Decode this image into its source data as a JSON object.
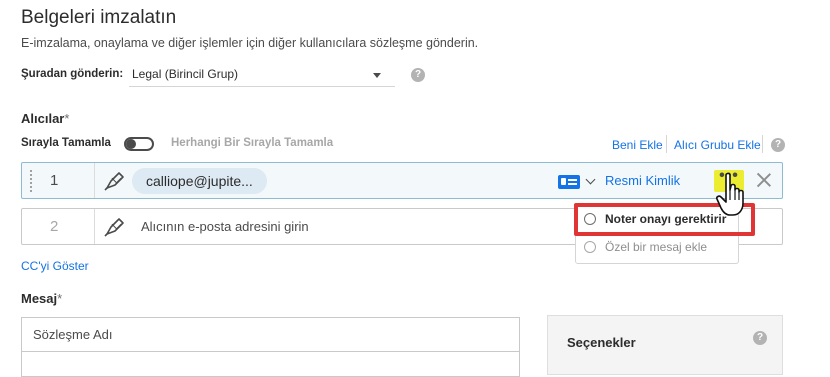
{
  "header": {
    "title": "Belgeleri imzalatın",
    "subtitle": "E-imzalama, onaylama ve diğer işlemler için diğer kullanıcılara sözleşme gönderin."
  },
  "send_from": {
    "label": "Şuradan gönderin:",
    "value": "Legal (Birincil Grup)",
    "help_glyph": "?"
  },
  "recipients": {
    "title": "Alıcılar",
    "required_mark": "*",
    "sequential_label": "Sırayla Tamamla",
    "any_order_label": "Herhangi Bir Sırayla Tamamla",
    "add_me_link": "Beni Ekle",
    "add_group_link": "Alıcı Grubu Ekle",
    "help_glyph": "?",
    "rows": [
      {
        "number": "1",
        "email": "calliope@jupite...",
        "auth_method": "Resmi Kimlik",
        "more_glyph": "•••"
      },
      {
        "number": "2",
        "placeholder": "Alıcının e-posta adresini girin"
      }
    ],
    "menu": {
      "items": [
        {
          "label": "Noter onayı gerektirir",
          "icon": "notary-icon"
        },
        {
          "label": "Özel bir mesaj ekle",
          "icon": "message-icon"
        }
      ]
    },
    "show_cc_link": "CC'yi Göster"
  },
  "message": {
    "title": "Mesaj",
    "required_mark": "*",
    "agreement_name_placeholder": "Sözleşme Adı"
  },
  "options": {
    "title": "Seçenekler",
    "help_glyph": "?"
  },
  "colors": {
    "link": "#1473e6",
    "highlight_border": "#e03535",
    "more_button_bg": "#ecec30",
    "active_row_border": "#8fbbd1",
    "chip_bg": "#dde9f3"
  }
}
